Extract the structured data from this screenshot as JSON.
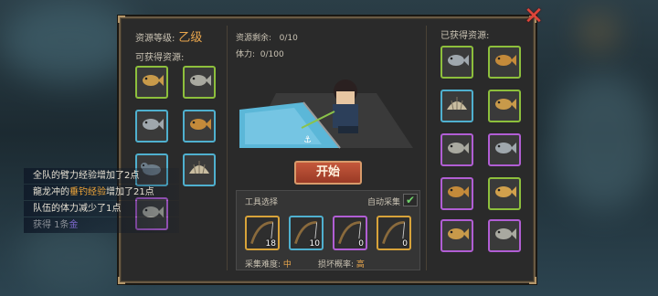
{
  "left": {
    "grade_label": "资源等级:",
    "grade_value": "乙级",
    "obtainable_label": "可获得资源:",
    "items": [
      {
        "icon": "fish-icon",
        "rarity": "green"
      },
      {
        "icon": "fish-icon",
        "rarity": "green"
      },
      {
        "icon": "fish-icon",
        "rarity": "blue"
      },
      {
        "icon": "fish-icon",
        "rarity": "blue"
      },
      {
        "icon": "seal-icon",
        "rarity": "blue"
      },
      {
        "icon": "shell-icon",
        "rarity": "blue"
      },
      {
        "icon": "fish-icon",
        "rarity": "purple"
      }
    ]
  },
  "center": {
    "remaining_label": "资源剩余:",
    "remaining_value": "0/10",
    "stamina_label": "体力:",
    "stamina_value": "0/100",
    "start_button": "开始",
    "tools_label": "工具选择",
    "auto_label": "自动采集",
    "auto_checked": true,
    "tools": [
      {
        "icon": "fishing-rod-icon",
        "count": "18",
        "rarity": "gold"
      },
      {
        "icon": "fishing-rod-icon",
        "count": "10",
        "rarity": "blue"
      },
      {
        "icon": "fishing-rod-icon",
        "count": "0",
        "rarity": "purple"
      },
      {
        "icon": "fishing-rod-icon",
        "count": "0",
        "rarity": "gold"
      }
    ],
    "difficulty_label": "采集难度:",
    "difficulty_value": "中",
    "damage_label": "损坏概率:",
    "damage_value": "高"
  },
  "right": {
    "obtained_label": "已获得资源:",
    "items": [
      {
        "icon": "fish-icon",
        "rarity": "green"
      },
      {
        "icon": "fish-icon",
        "rarity": "green"
      },
      {
        "icon": "shell-icon",
        "rarity": "blue"
      },
      {
        "icon": "fish-icon",
        "rarity": "green"
      },
      {
        "icon": "fish-icon",
        "rarity": "purple"
      },
      {
        "icon": "fish-icon",
        "rarity": "purple"
      },
      {
        "icon": "fish-icon",
        "rarity": "purple"
      },
      {
        "icon": "fish-icon",
        "rarity": "green"
      },
      {
        "icon": "fish-icon",
        "rarity": "purple"
      },
      {
        "icon": "fish-icon",
        "rarity": "purple"
      }
    ]
  },
  "log": {
    "line1": "全队的臂力经验增加了2点",
    "line2_a": "龍龙冲的",
    "line2_hl": "垂钓经验",
    "line2_b": "增加了21点",
    "line3": "队伍的体力减少了1点",
    "line4_a": "获得 1条",
    "line4_hl": "金"
  },
  "colors": {
    "green": "#8dbf3c",
    "blue": "#4fb0cf",
    "purple": "#b15ed4",
    "gold": "#d8a33a",
    "accent": "#e9a64d"
  }
}
